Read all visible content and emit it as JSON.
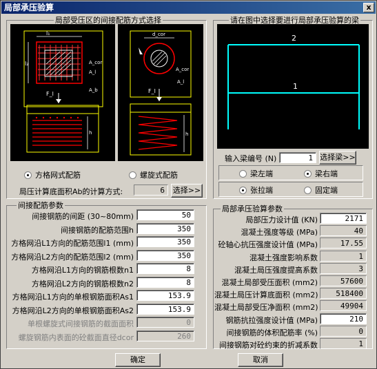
{
  "window": {
    "title": "局部承压验算",
    "close_glyph": "x"
  },
  "left_group": {
    "title": "局部受压区的间接配筋方式选择",
    "radio_mesh": "方格网式配筋",
    "radio_spiral": "螺旋式配筋",
    "area_label": "局压计算底面积Ab的计算方式:",
    "area_value": "6",
    "area_button": "选择>>",
    "diagram_labels": {
      "l1": "l₁",
      "l2": "l₂",
      "b": "b",
      "acor": "A_cor",
      "al": "A_l",
      "ab": "A_b",
      "fl": "F_l",
      "dcor": "d_cor",
      "h": "h"
    }
  },
  "indirect_group": {
    "title": "间接配筋参数",
    "rows": [
      {
        "label": "间接钢筋的间距 (30~80mm)",
        "value": "50",
        "enabled": true
      },
      {
        "label": "间接钢筋的配筋范围h",
        "value": "350",
        "enabled": true
      },
      {
        "label": "方格网沿L1方向的配筋范围l1 (mm)",
        "value": "350",
        "enabled": true
      },
      {
        "label": "方格网沿L2方向的配筋范围l2 (mm)",
        "value": "350",
        "enabled": true
      },
      {
        "label": "方格网沿L1方向的钢筋根数n1",
        "value": "8",
        "enabled": true
      },
      {
        "label": "方格网沿L2方向的钢筋根数n2",
        "value": "8",
        "enabled": true
      },
      {
        "label": "方格网沿L1方向的单根钢筋面积As1",
        "value": "153.9",
        "enabled": true
      },
      {
        "label": "方格网沿L2方向的单根钢筋面积As2",
        "value": "153.9",
        "enabled": true
      },
      {
        "label": "单根螺旋式间接钢筋的截面面积",
        "value": "0",
        "enabled": false
      },
      {
        "label": "螺旋钢筋内表面的砼截面直径dcor",
        "value": "260",
        "enabled": false
      }
    ]
  },
  "right_group": {
    "title": "请在图中选择要进行局部承压验算的梁",
    "beam_labels": [
      "2",
      "1"
    ],
    "beam_input_label": "输入梁编号 (N)",
    "beam_input_value": "1",
    "beam_button": "选择梁>>",
    "radio_left": "梁左端",
    "radio_right": "梁右端",
    "radio_tension": "张拉端",
    "radio_fixed": "固定端"
  },
  "check_group": {
    "title": "局部承压验算参数",
    "rows": [
      {
        "label": "局部压力设计值 (KN)",
        "value": "2171",
        "editable": true
      },
      {
        "label": "混凝土强度等级 (MPa)",
        "value": "40",
        "editable": false
      },
      {
        "label": "砼轴心抗压强度设计值 (MPa)",
        "value": "17.55",
        "editable": false
      },
      {
        "label": "混凝土强度影响系数",
        "value": "1",
        "editable": false
      },
      {
        "label": "混凝土局压强度提高系数",
        "value": "3",
        "editable": false
      },
      {
        "label": "混凝土局部受压面积 (mm2)",
        "value": "57600",
        "editable": false
      },
      {
        "label": "混凝土局压计算底面积 (mm2)",
        "value": "518400",
        "editable": false
      },
      {
        "label": "混凝土局部受压净面积 (mm2)",
        "value": "49904",
        "editable": false
      },
      {
        "label": "钢筋抗拉强度设计值 (MPa)",
        "value": "210",
        "editable": true
      },
      {
        "label": "间接钢筋的体积配筋率 (%)",
        "value": "0",
        "editable": false
      },
      {
        "label": "间接钢筋对砼约束的折减系数",
        "value": "1",
        "editable": false
      }
    ]
  },
  "footer": {
    "ok": "确定",
    "cancel": "取消"
  }
}
